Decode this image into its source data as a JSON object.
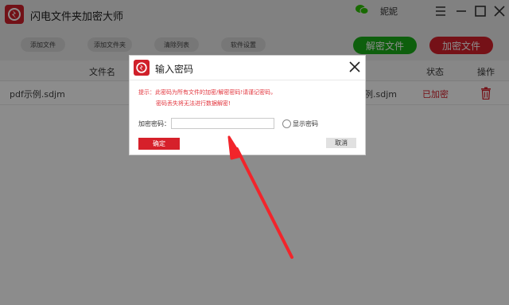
{
  "app": {
    "title": "闪电文件夹加密大师",
    "user_name": "妮妮",
    "user_icon": "wechat-icon",
    "controls": [
      "menu-icon",
      "minimize-icon",
      "maximize-icon",
      "close-icon"
    ]
  },
  "toolbar": {
    "add_file": "添加文件",
    "add_folder": "添加文件夹",
    "clear_list": "清除列表",
    "settings": "软件设置",
    "decrypt": "解密文件",
    "encrypt": "加密文件"
  },
  "table": {
    "headers": {
      "name": "文件名",
      "status": "状态",
      "action": "操作"
    },
    "rows": [
      {
        "name": "pdf示例.sdjm",
        "name_right": "例.sdjm",
        "status": "已加密",
        "action_icon": "trash-icon"
      }
    ]
  },
  "dialog": {
    "title": "输入密码",
    "hint_line1": "提示：此密码为所有文件的加密/解密密码!请谨记密码，",
    "hint_line2": "密码丢失将无法进行数据解密!",
    "password_label": "加密密码：",
    "password_value": "",
    "show_password_label": "显示密码",
    "show_password_checked": false,
    "ok_label": "确定",
    "cancel_label": "取消"
  },
  "colors": {
    "brand_red": "#d6202a",
    "decrypt_green": "#1aad19",
    "arrow_red": "#f2252b",
    "hint_red": "#e2343c"
  }
}
